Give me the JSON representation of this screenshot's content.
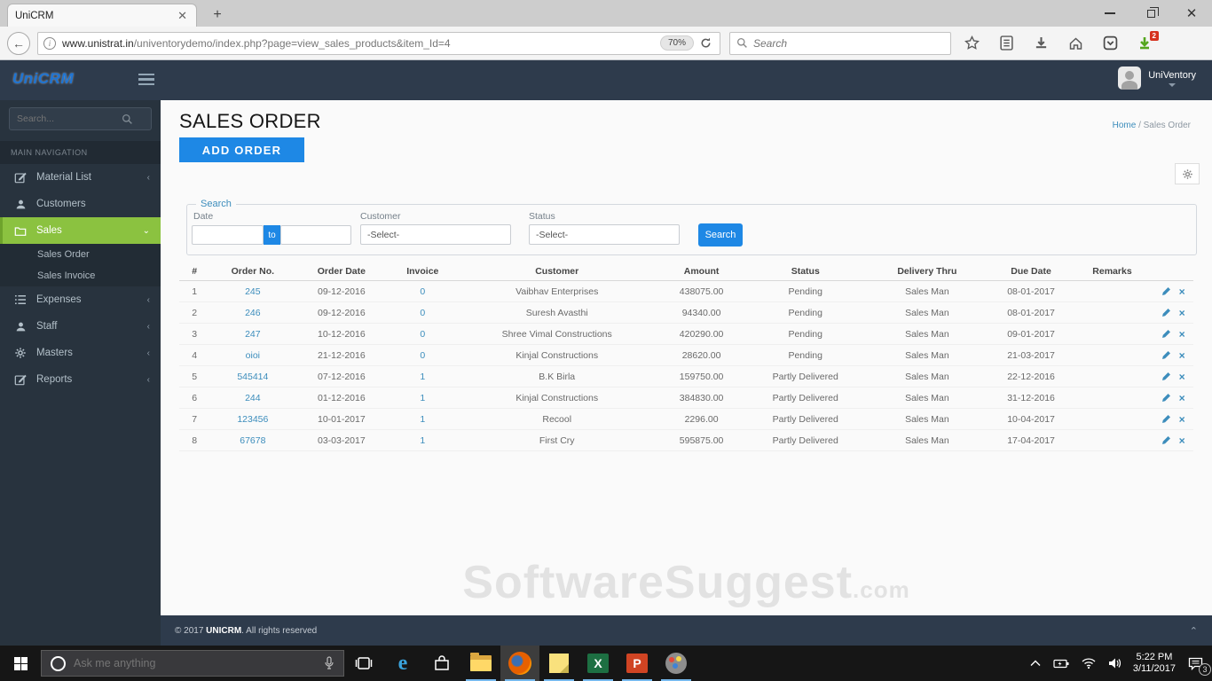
{
  "browser": {
    "tab_title": "UniCRM",
    "url_domain": "www.unistrat.in",
    "url_path": "/univentorydemo/index.php?page=view_sales_products&item_Id=4",
    "zoom_badge": "70%",
    "search_placeholder": "Search",
    "downloads_badge": "2"
  },
  "app_header": {
    "logo": "UniCRM",
    "user_name": "UniVentory"
  },
  "sidebar": {
    "search_placeholder": "Search...",
    "section_label": "MAIN NAVIGATION",
    "items": [
      {
        "label": "Material List",
        "icon": "edit-icon",
        "chevron": "‹"
      },
      {
        "label": "Customers",
        "icon": "user-icon",
        "chevron": ""
      },
      {
        "label": "Sales",
        "icon": "folder-icon",
        "chevron": "⌄",
        "active": true
      },
      {
        "label": "Expenses",
        "icon": "list-icon",
        "chevron": "‹"
      },
      {
        "label": "Staff",
        "icon": "user-icon",
        "chevron": "‹"
      },
      {
        "label": "Masters",
        "icon": "gear-icon",
        "chevron": "‹"
      },
      {
        "label": "Reports",
        "icon": "edit-icon",
        "chevron": "‹"
      }
    ],
    "submenu": [
      {
        "label": "Sales Order"
      },
      {
        "label": "Sales Invoice"
      }
    ]
  },
  "page": {
    "title": "SALES ORDER",
    "add_button": "ADD ORDER",
    "breadcrumb_home": "Home",
    "breadcrumb_sep": "/",
    "breadcrumb_current": "Sales Order"
  },
  "filters": {
    "legend": "Search",
    "date_label": "Date",
    "to_label": "to",
    "customer_label": "Customer",
    "customer_value": "-Select-",
    "status_label": "Status",
    "status_value": "-Select-",
    "search_button": "Search"
  },
  "table": {
    "headers": [
      "#",
      "Order No.",
      "Order Date",
      "Invoice",
      "Customer",
      "Amount",
      "Status",
      "Delivery Thru",
      "Due Date",
      "Remarks",
      ""
    ],
    "rows": [
      {
        "num": "1",
        "order_no": "245",
        "order_date": "09-12-2016",
        "invoice": "0",
        "customer": "Vaibhav Enterprises",
        "amount": "438075.00",
        "status": "Pending",
        "delivery": "Sales Man",
        "due_date": "08-01-2017",
        "remarks": ""
      },
      {
        "num": "2",
        "order_no": "246",
        "order_date": "09-12-2016",
        "invoice": "0",
        "customer": "Suresh Avasthi",
        "amount": "94340.00",
        "status": "Pending",
        "delivery": "Sales Man",
        "due_date": "08-01-2017",
        "remarks": ""
      },
      {
        "num": "3",
        "order_no": "247",
        "order_date": "10-12-2016",
        "invoice": "0",
        "customer": "Shree Vimal Constructions",
        "amount": "420290.00",
        "status": "Pending",
        "delivery": "Sales Man",
        "due_date": "09-01-2017",
        "remarks": ""
      },
      {
        "num": "4",
        "order_no": "oioi",
        "order_date": "21-12-2016",
        "invoice": "0",
        "customer": "Kinjal Constructions",
        "amount": "28620.00",
        "status": "Pending",
        "delivery": "Sales Man",
        "due_date": "21-03-2017",
        "remarks": ""
      },
      {
        "num": "5",
        "order_no": "545414",
        "order_date": "07-12-2016",
        "invoice": "1",
        "customer": "B.K Birla",
        "amount": "159750.00",
        "status": "Partly Delivered",
        "delivery": "Sales Man",
        "due_date": "22-12-2016",
        "remarks": ""
      },
      {
        "num": "6",
        "order_no": "244",
        "order_date": "01-12-2016",
        "invoice": "1",
        "customer": "Kinjal Constructions",
        "amount": "384830.00",
        "status": "Partly Delivered",
        "delivery": "Sales Man",
        "due_date": "31-12-2016",
        "remarks": ""
      },
      {
        "num": "7",
        "order_no": "123456",
        "order_date": "10-01-2017",
        "invoice": "1",
        "customer": "Recool",
        "amount": "2296.00",
        "status": "Partly Delivered",
        "delivery": "Sales Man",
        "due_date": "10-04-2017",
        "remarks": ""
      },
      {
        "num": "8",
        "order_no": "67678",
        "order_date": "03-03-2017",
        "invoice": "1",
        "customer": "First Cry",
        "amount": "595875.00",
        "status": "Partly Delivered",
        "delivery": "Sales Man",
        "due_date": "17-04-2017",
        "remarks": ""
      }
    ]
  },
  "watermark": {
    "text": "SoftwareSuggest",
    "suffix": ".com"
  },
  "footer": {
    "prefix": "© 2017 ",
    "brand": "UNICRM",
    "suffix": ". All rights reserved"
  },
  "taskbar": {
    "cortana_placeholder": "Ask me anything",
    "time": "5:22 PM",
    "date": "3/11/2017",
    "notification_count": "3"
  },
  "colors": {
    "accent_blue": "#1e88e5",
    "link_blue": "#3c8dbc",
    "active_green": "#8bc240",
    "header_dark": "#2e3b4c",
    "sidebar_dark": "#28333e"
  }
}
